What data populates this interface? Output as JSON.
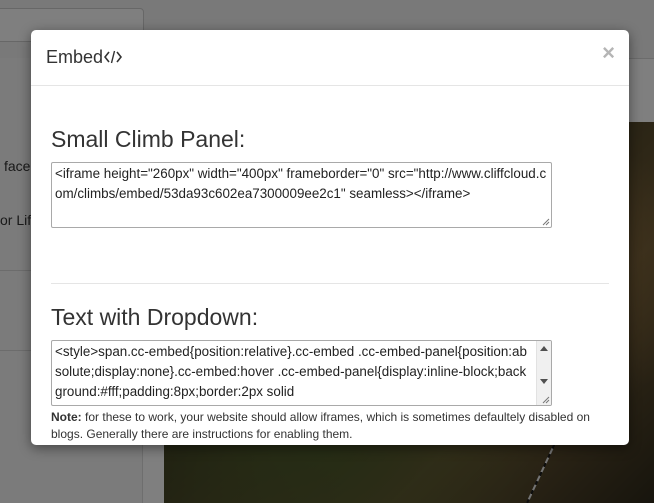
{
  "background": {
    "left_snippets": [
      "face",
      "or Lif"
    ]
  },
  "modal": {
    "title": "Embed",
    "title_icon": "code-icon",
    "close_label": "×",
    "sections": [
      {
        "heading": "Small Climb Panel:",
        "code": "<iframe height=\"260px\" width=\"400px\" frameborder=\"0\" src=\"http://www.cliffcloud.com/climbs/embed/53da93c602ea7300009ee2c1\" seamless></iframe>"
      },
      {
        "heading": "Text with Dropdown:",
        "code": "<style>span.cc-embed{position:relative}.cc-embed .cc-embed-panel{position:absolute;display:none}.cc-embed:hover .cc-embed-panel{display:inline-block;background:#fff;padding:8px;border:2px solid"
      }
    ],
    "note": {
      "label": "Note:",
      "text": "for these to work, your website should allow iframes, which is sometimes defaultely disabled on blogs. Generally there are instructions for enabling them."
    }
  },
  "colors": {
    "backdrop": "rgba(0,0,0,0.5)",
    "text": "#333333",
    "close": "#b5b5b5",
    "border": "#a9a9a9"
  }
}
